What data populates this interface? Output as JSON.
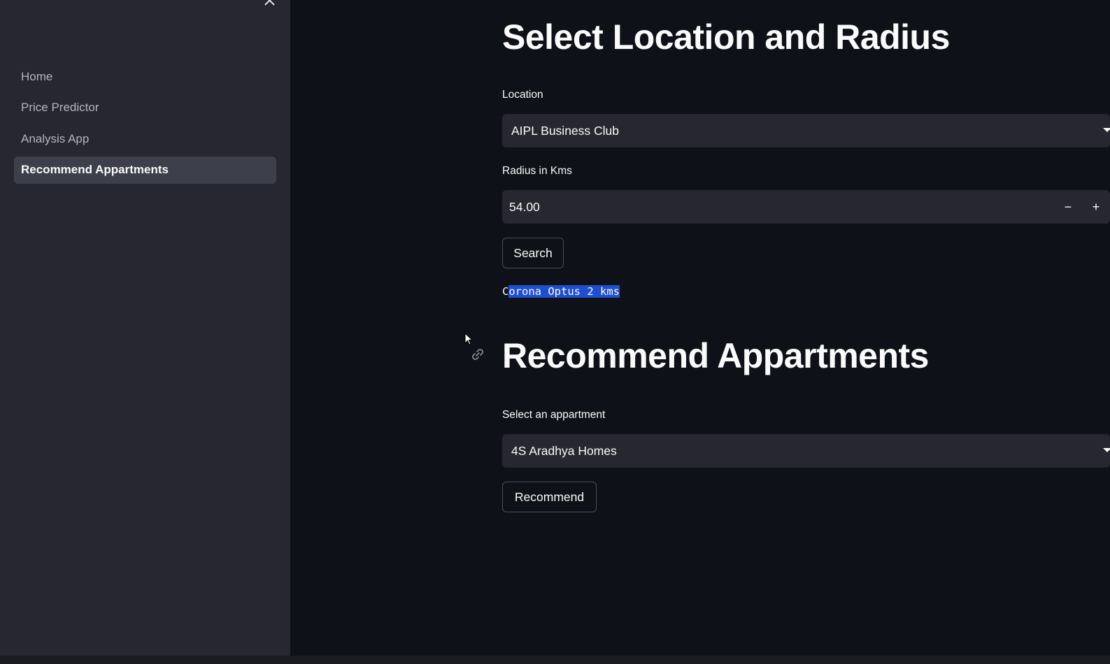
{
  "sidebar": {
    "close_icon": "close-icon",
    "items": [
      {
        "label": "Home",
        "active": false
      },
      {
        "label": "Price Predictor",
        "active": false
      },
      {
        "label": "Analysis App",
        "active": false
      },
      {
        "label": "Recommend Appartments",
        "active": true
      }
    ]
  },
  "location_section": {
    "title": "Select Location and Radius",
    "location_label": "Location",
    "location_value": "AIPL Business Club",
    "radius_label": "Radius in Kms",
    "radius_value": "54.00",
    "decrement_symbol": "−",
    "increment_symbol": "+",
    "search_button": "Search",
    "result_first_char": "C",
    "result_rest": "orona Optus 2 kms"
  },
  "recommend_section": {
    "title": "Recommend Appartments",
    "apartment_label": "Select an appartment",
    "apartment_value": "4S Aradhya Homes",
    "recommend_button": "Recommend"
  },
  "colors": {
    "background": "#0e1117",
    "sidebar": "#262730",
    "input_bg": "#262730",
    "selection": "#1e4fcf"
  }
}
